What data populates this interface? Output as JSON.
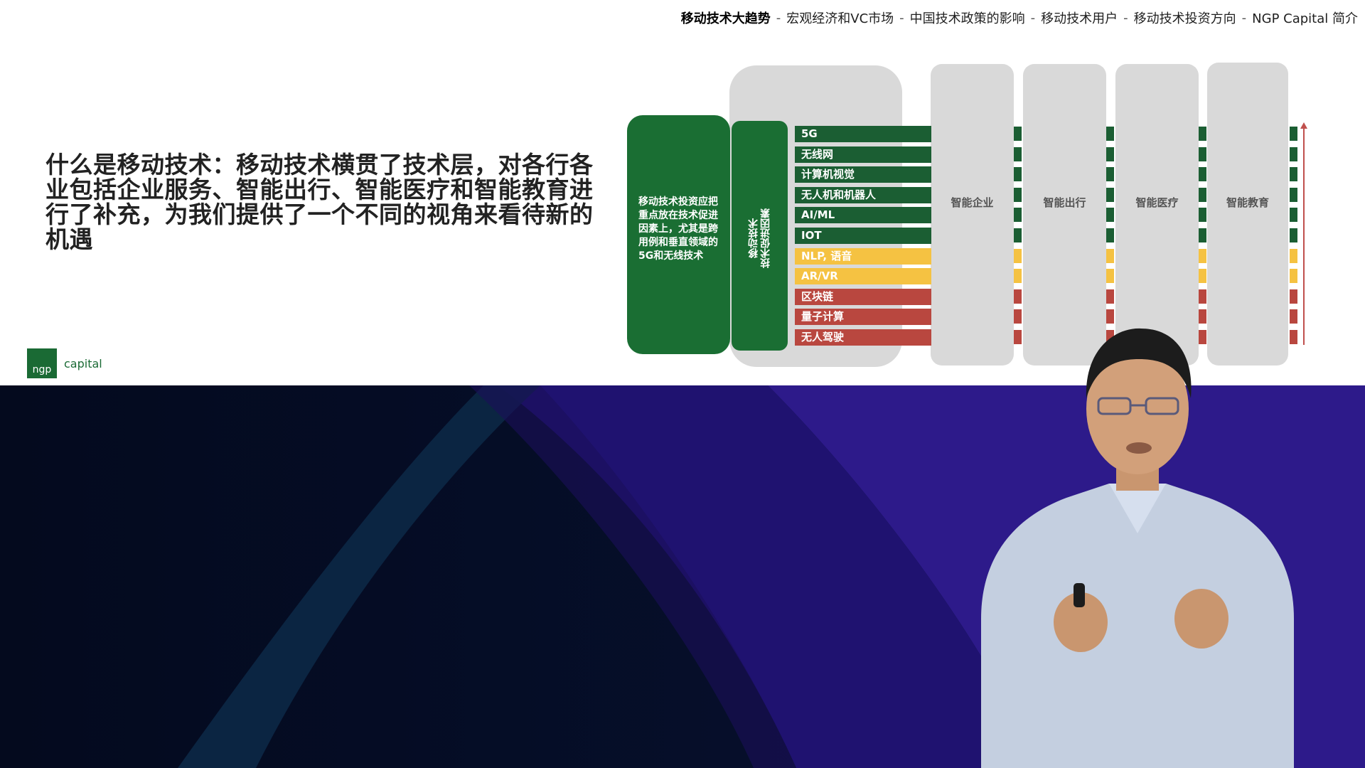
{
  "nav": {
    "items": [
      "移动技术大趋势",
      "宏观经济和VC市场",
      "中国技术政策的影响",
      "移动技术用户",
      "移动技术投资方向",
      "NGP Capital 简介"
    ],
    "active_index": 0,
    "separator": "-"
  },
  "headline": "什么是移动技术：移动技术横贯了技术层，对各行各业包括企业服务、智能出行、智能医疗和智能教育进行了补充，为我们提供了一个不同的视角来看待新的机遇",
  "logo": {
    "mark": "ngp",
    "word": "capital"
  },
  "diagram": {
    "investment_note": "移动技术投资应把重点放在技术促进因素上，尤其是跨用例和垂直领域的5G和无线技术",
    "enablers_label_line1": "移动技术",
    "enablers_label_line2": "技术促进因素",
    "technologies": [
      {
        "label": "5G",
        "tier": "green"
      },
      {
        "label": "无线网",
        "tier": "green"
      },
      {
        "label": "计算机视觉",
        "tier": "green"
      },
      {
        "label": "无人机和机器人",
        "tier": "green"
      },
      {
        "label": "AI/ML",
        "tier": "green"
      },
      {
        "label": "IOT",
        "tier": "green"
      },
      {
        "label": "NLP, 语音",
        "tier": "yellow"
      },
      {
        "label": "AR/VR",
        "tier": "yellow"
      },
      {
        "label": "区块链",
        "tier": "red"
      },
      {
        "label": "量子计算",
        "tier": "red"
      },
      {
        "label": "无人驾驶",
        "tier": "red"
      }
    ],
    "verticals": [
      "智能企业",
      "智能出行",
      "智能医疗",
      "智能教育"
    ],
    "colors": {
      "green": "#1b5e33",
      "yellow": "#f5c242",
      "red": "#b9473f",
      "block": "#1a6e33",
      "pill": "#d9d9d9"
    }
  }
}
